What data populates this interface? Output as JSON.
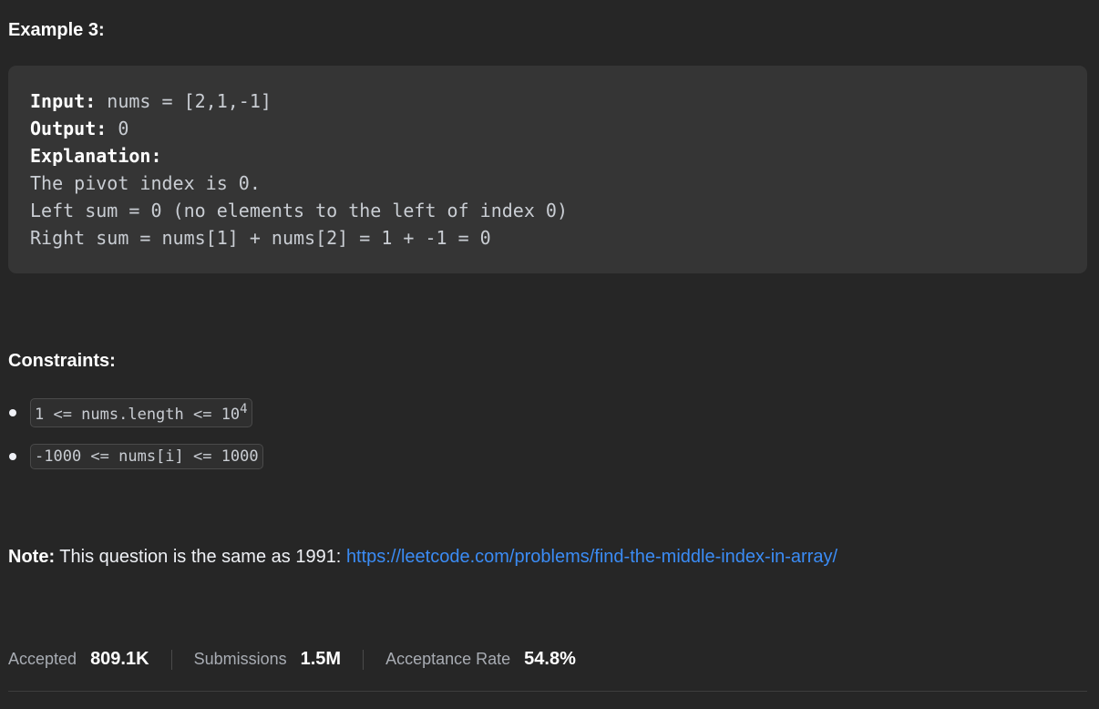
{
  "example": {
    "heading": "Example 3:",
    "input_label": "Input:",
    "input_value": " nums = [2,1,-1]",
    "output_label": "Output:",
    "output_value": " 0",
    "explanation_label": "Explanation:",
    "explanation_lines": [
      "The pivot index is 0.",
      "Left sum = 0 (no elements to the left of index 0)",
      "Right sum = nums[1] + nums[2] = 1 + -1 = 0"
    ]
  },
  "constraints": {
    "heading": "Constraints:",
    "items": [
      {
        "text": "1 <= nums.length <= 10",
        "sup": "4"
      },
      {
        "text": "-1000 <= nums[i] <= 1000",
        "sup": ""
      }
    ]
  },
  "note": {
    "label": "Note:",
    "text": " This question is the same as 1991: ",
    "link": "https://leetcode.com/problems/find-the-middle-index-in-array/"
  },
  "stats": {
    "accepted_label": "Accepted",
    "accepted_value": "809.1K",
    "submissions_label": "Submissions",
    "submissions_value": "1.5M",
    "rate_label": "Acceptance Rate",
    "rate_value": "54.8%"
  },
  "colors": {
    "background": "#262626",
    "code_block": "#353535",
    "link": "#3b8cf5"
  }
}
